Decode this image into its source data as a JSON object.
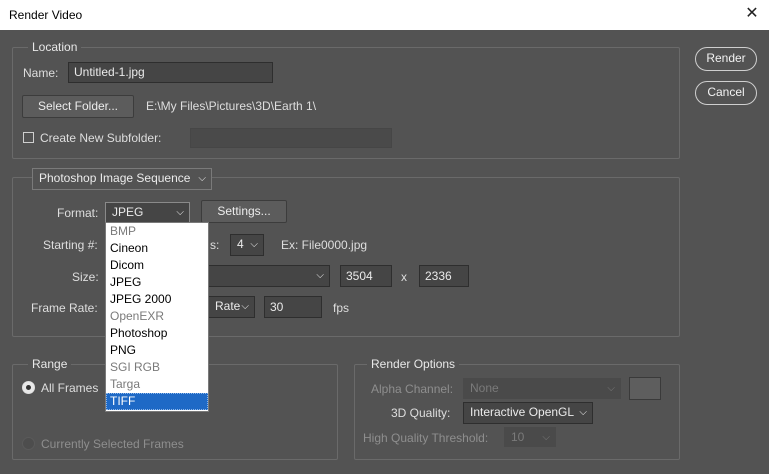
{
  "window": {
    "title": "Render Video",
    "close_glyph": "✕"
  },
  "buttons": {
    "render": "Render",
    "cancel": "Cancel"
  },
  "location": {
    "legend": "Location",
    "name_label": "Name:",
    "name_value": "Untitled-1.jpg",
    "select_folder": "Select Folder...",
    "folder_path": "E:\\My Files\\Pictures\\3D\\Earth 1\\",
    "create_subfolder": "Create New Subfolder:",
    "subfolder_value": ""
  },
  "sequence": {
    "type_select": "Photoshop Image Sequence",
    "format_label": "Format:",
    "format_value": "JPEG",
    "settings_button": "Settings...",
    "starting_label": "Starting #:",
    "digits_suffix": "s:",
    "digits_value": "4",
    "example": "Ex: File0000.jpg",
    "size_label": "Size:",
    "width": "3504",
    "x_sep": "x",
    "height": "2336",
    "frame_rate_label": "Frame Rate:",
    "frame_rate_select": "Rate",
    "fps_value": "30",
    "fps_unit": "fps"
  },
  "format_options": [
    {
      "label": "BMP",
      "state": "grey"
    },
    {
      "label": "Cineon",
      "state": "normal"
    },
    {
      "label": "Dicom",
      "state": "normal"
    },
    {
      "label": "JPEG",
      "state": "normal"
    },
    {
      "label": "JPEG 2000",
      "state": "normal"
    },
    {
      "label": "OpenEXR",
      "state": "grey"
    },
    {
      "label": "Photoshop",
      "state": "normal"
    },
    {
      "label": "PNG",
      "state": "normal"
    },
    {
      "label": "SGI RGB",
      "state": "grey"
    },
    {
      "label": "Targa",
      "state": "grey"
    },
    {
      "label": "TIFF",
      "state": "selected"
    }
  ],
  "range": {
    "legend": "Range",
    "all_frames": "All Frames",
    "selected_frames": "Currently Selected Frames"
  },
  "render_options": {
    "legend": "Render Options",
    "alpha_label": "Alpha Channel:",
    "alpha_value": "None",
    "quality_label": "3D Quality:",
    "quality_value": "Interactive OpenGL",
    "threshold_label": "High Quality Threshold:",
    "threshold_value": "10"
  },
  "colors": {
    "background": "#535353",
    "selection": "#1e69c6"
  }
}
